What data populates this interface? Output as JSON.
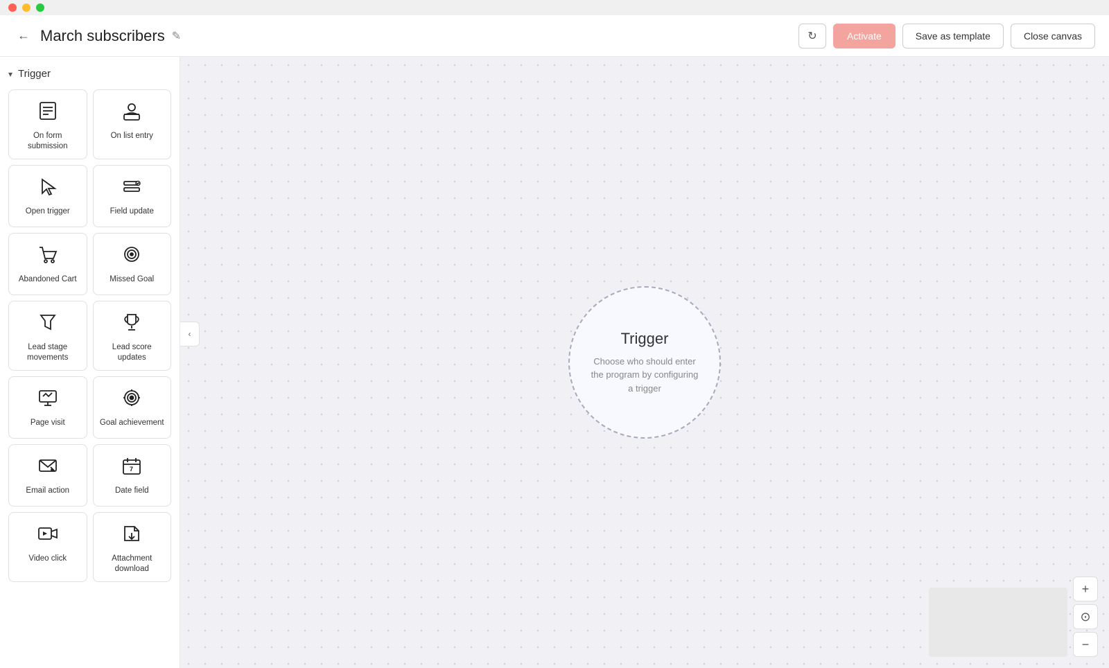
{
  "titlebar": {
    "dots": [
      "red",
      "yellow",
      "green"
    ]
  },
  "header": {
    "back_icon": "←",
    "title": "March subscribers",
    "edit_icon": "✎",
    "refresh_icon": "↻",
    "activate_label": "Activate",
    "save_template_label": "Save as template",
    "close_canvas_label": "Close canvas"
  },
  "sidebar": {
    "section_label": "Trigger",
    "collapse_icon": "‹",
    "items": [
      {
        "id": "on-form-submission",
        "label": "On form submission",
        "icon": "form"
      },
      {
        "id": "on-list-entry",
        "label": "On list entry",
        "icon": "person"
      },
      {
        "id": "open-trigger",
        "label": "Open trigger",
        "icon": "cursor"
      },
      {
        "id": "field-update",
        "label": "Field update",
        "icon": "field"
      },
      {
        "id": "abandoned-cart",
        "label": "Abandoned Cart",
        "icon": "cart"
      },
      {
        "id": "missed-goal",
        "label": "Missed Goal",
        "icon": "target"
      },
      {
        "id": "lead-stage-movements",
        "label": "Lead stage movements",
        "icon": "funnel"
      },
      {
        "id": "lead-score-updates",
        "label": "Lead score updates",
        "icon": "trophy"
      },
      {
        "id": "page-visit",
        "label": "Page visit",
        "icon": "monitor"
      },
      {
        "id": "goal-achievement",
        "label": "Goal achievement",
        "icon": "goal"
      },
      {
        "id": "email-action",
        "label": "Email action",
        "icon": "email"
      },
      {
        "id": "date-field",
        "label": "Date field",
        "icon": "calendar"
      },
      {
        "id": "video-click",
        "label": "Video click",
        "icon": "video"
      },
      {
        "id": "attachment-download",
        "label": "Attachment download",
        "icon": "attachment"
      }
    ]
  },
  "canvas": {
    "trigger_node": {
      "title": "Trigger",
      "description": "Choose who should enter the program by configuring a trigger"
    }
  },
  "zoom": {
    "zoom_in_icon": "+",
    "reset_icon": "⊙",
    "zoom_out_icon": "−"
  }
}
